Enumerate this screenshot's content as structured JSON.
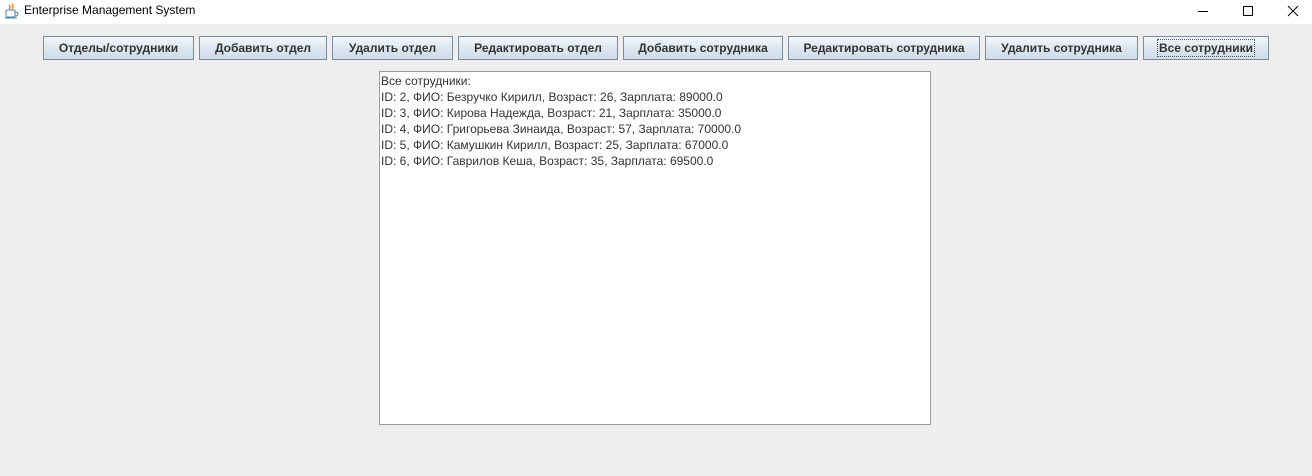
{
  "window": {
    "title": "Enterprise Management System",
    "icon": "java-cup-icon",
    "controls": [
      "minimize-icon",
      "maximize-icon",
      "close-icon"
    ]
  },
  "toolbar": {
    "buttons": [
      {
        "label": "Отделы/сотрудники"
      },
      {
        "label": "Добавить отдел"
      },
      {
        "label": "Удалить отдел"
      },
      {
        "label": "Редактировать отдел"
      },
      {
        "label": "Добавить сотрудника"
      },
      {
        "label": "Редактировать сотрудника"
      },
      {
        "label": "Удалить сотрудника"
      },
      {
        "label": "Все сотрудники",
        "focused": true
      }
    ]
  },
  "output": {
    "header": "Все сотрудники:",
    "lines": [
      "ID: 2, ФИО: Безручко Кирилл, Возраст: 26, Зарплата: 89000.0",
      "ID: 3, ФИО: Кирова Надежда, Возраст: 21, Зарплата: 35000.0",
      "ID: 4, ФИО: Григорьева Зинаида, Возраст: 57, Зарплата: 70000.0",
      "ID: 5, ФИО: Камушкин Кирилл, Возраст: 25, Зарплата: 67000.0",
      "ID: 6, ФИО: Гаврилов Кеша, Возраст: 35, Зарплата: 69500.0"
    ]
  },
  "colors": {
    "window_bg": "#eeeeee",
    "titlebar_bg": "#ffffff",
    "button_border": "#7a8a99",
    "text": "#333333"
  }
}
